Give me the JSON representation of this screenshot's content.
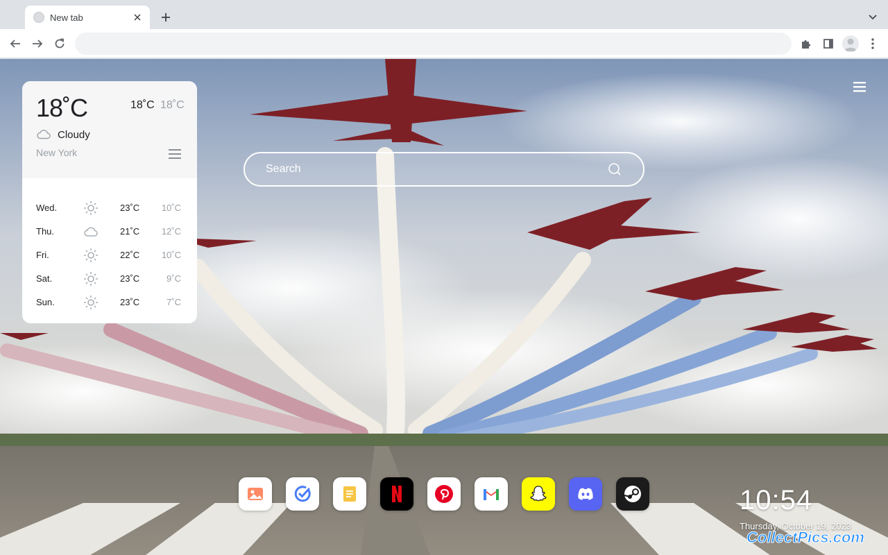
{
  "browser": {
    "tab_title": "New tab",
    "omnibox_value": ""
  },
  "search": {
    "placeholder": "Search"
  },
  "weather": {
    "current_temp": "18˚C",
    "high": "18˚C",
    "low": "18˚C",
    "condition": "Cloudy",
    "condition_icon": "cloud-icon",
    "city": "New York",
    "forecast": [
      {
        "day": "Wed.",
        "icon": "sun-icon",
        "high": "23˚C",
        "low": "10˚C"
      },
      {
        "day": "Thu.",
        "icon": "cloud-icon",
        "high": "21˚C",
        "low": "12˚C"
      },
      {
        "day": "Fri.",
        "icon": "sun-icon",
        "high": "22˚C",
        "low": "10˚C"
      },
      {
        "day": "Sat.",
        "icon": "sun-icon",
        "high": "23˚C",
        "low": "9˚C"
      },
      {
        "day": "Sun.",
        "icon": "sun-icon",
        "high": "23˚C",
        "low": "7˚C"
      }
    ]
  },
  "dock": [
    {
      "name": "wallpaper-app",
      "icon": "image-icon",
      "bg": "#ffffff"
    },
    {
      "name": "todo-app",
      "icon": "check-circle-icon",
      "bg": "#ffffff"
    },
    {
      "name": "notes-app",
      "icon": "note-icon",
      "bg": "#ffffff"
    },
    {
      "name": "netflix",
      "icon": "netflix-icon",
      "bg": "#000000"
    },
    {
      "name": "pinterest",
      "icon": "pinterest-icon",
      "bg": "#ffffff"
    },
    {
      "name": "gmail",
      "icon": "gmail-icon",
      "bg": "#ffffff"
    },
    {
      "name": "snapchat",
      "icon": "snapchat-icon",
      "bg": "#fffc00"
    },
    {
      "name": "discord",
      "icon": "discord-icon",
      "bg": "#5865f2"
    },
    {
      "name": "steam",
      "icon": "steam-icon",
      "bg": "#1b1b1b"
    }
  ],
  "clock": {
    "time": "10:54",
    "date": "Thursday, October 19, 2023"
  },
  "watermark": "CollectPics.com",
  "colors": {
    "accent_blue": "#1e8dff",
    "chrome_bg": "#dee1e6",
    "muted_text": "#9aa0a6"
  }
}
